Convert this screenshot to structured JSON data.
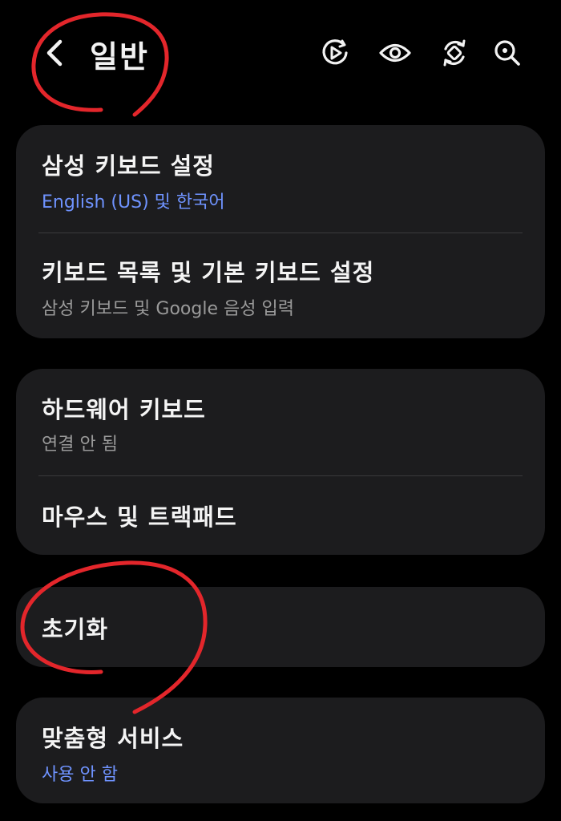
{
  "header": {
    "title": "일반",
    "icons": [
      "back-chevron-icon",
      "play-circle-icon",
      "eye-icon",
      "rotate-sync-icon",
      "search-icon"
    ]
  },
  "cards": [
    {
      "items": [
        {
          "title": "삼성 키보드 설정",
          "subtitle": "English (US) 및 한국어",
          "subtitle_style": "blue"
        },
        {
          "title": "키보드 목록 및 기본 키보드 설정",
          "subtitle": "삼성 키보드 및 Google 음성 입력",
          "subtitle_style": "gray"
        }
      ]
    },
    {
      "items": [
        {
          "title": "하드웨어 키보드",
          "subtitle": "연결 안 됨",
          "subtitle_style": "gray"
        },
        {
          "title": "마우스 및 트랙패드"
        }
      ]
    },
    {
      "items": [
        {
          "title": "초기화"
        }
      ]
    },
    {
      "items": [
        {
          "title": "맞춤형 서비스",
          "subtitle": "사용 안 함",
          "subtitle_style": "blue"
        }
      ]
    }
  ],
  "colors": {
    "background": "#000000",
    "card": "#1c1c1e",
    "accent_blue": "#6f93ff",
    "secondary_gray": "#9a9a9a",
    "annotation_red": "#e3262b"
  }
}
